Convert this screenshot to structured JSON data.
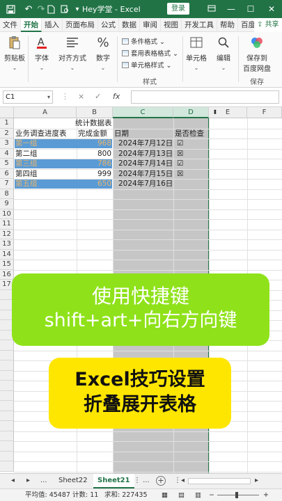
{
  "titlebar": {
    "title": "Hey学堂  -  Excel",
    "login": "登录",
    "icons": [
      "save-icon",
      "undo-icon",
      "redo-icon",
      "new-file-icon",
      "print-preview-icon",
      "customize-icon"
    ]
  },
  "tabs": [
    "文件",
    "开始",
    "插入",
    "页面布局",
    "公式",
    "数据",
    "审阅",
    "视图",
    "开发工具",
    "帮助",
    "百度网盘"
  ],
  "share": "共享",
  "ribbon": {
    "clipboard": "剪贴板",
    "font": "字体",
    "alignment": "对齐方式",
    "number": "数字",
    "conditional_format": "条件格式",
    "table_format": "套用表格格式",
    "cell_style": "单元格样式",
    "style_group": "样式",
    "cells": "单元格",
    "editing": "编辑",
    "save_to": "保存到",
    "baidu_pan": "百度网盘",
    "save_group": "保存"
  },
  "formula_bar": {
    "name_box": "C1",
    "cancel": "×",
    "confirm": "✓",
    "fx": "fx",
    "value": ""
  },
  "columns": [
    "A",
    "B",
    "C",
    "D",
    "E",
    "F"
  ],
  "rows": [
    "1",
    "2",
    "3",
    "4",
    "5",
    "6",
    "7",
    "8",
    "9",
    "10",
    "11",
    "12",
    "13",
    "14",
    "15",
    "16",
    "17"
  ],
  "sheet": {
    "title": "统计数据表",
    "headers": [
      "业务调查进度表",
      "完成金额",
      "日期",
      "是否检查"
    ],
    "data": [
      {
        "group": "第一组",
        "amount": "968",
        "date": "2024年7月12日",
        "check": "☑"
      },
      {
        "group": "第二组",
        "amount": "800",
        "date": "2024年7月13日",
        "check": "☒"
      },
      {
        "group": "第三组",
        "amount": "786",
        "date": "2024年7月14日",
        "check": "☑"
      },
      {
        "group": "第四组",
        "amount": "999",
        "date": "2024年7月15日",
        "check": "☒"
      },
      {
        "group": "第五组",
        "amount": "650",
        "date": "2024年7月16日",
        "check": ""
      }
    ],
    "note": "Hey学堂"
  },
  "overlay": {
    "green_line1": "使用快捷键",
    "green_line2": "shift+art+向右方向键",
    "yellow_line1": "Excel技巧设置",
    "yellow_line2": "折叠展开表格"
  },
  "sheet_tabs": {
    "more_left": "...",
    "tabs": [
      "Sheet22",
      "Sheet21"
    ],
    "more_right": "⋮ ..."
  },
  "status": {
    "average": "平均值: 45487",
    "count": "计数: 11",
    "sum": "求和: 227435"
  },
  "colors": {
    "excel_green": "#217346",
    "highlight_blue": "#5b9bd5",
    "banner_green": "#8fe21a",
    "banner_yellow": "#ffe600"
  }
}
